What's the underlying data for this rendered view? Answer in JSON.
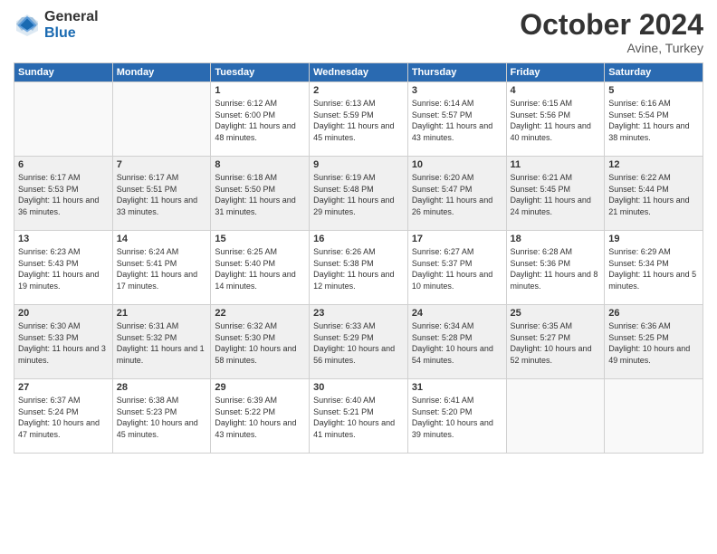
{
  "logo": {
    "general": "General",
    "blue": "Blue"
  },
  "title": "October 2024",
  "location": "Avine, Turkey",
  "days_of_week": [
    "Sunday",
    "Monday",
    "Tuesday",
    "Wednesday",
    "Thursday",
    "Friday",
    "Saturday"
  ],
  "weeks": [
    [
      {
        "day": "",
        "content": ""
      },
      {
        "day": "",
        "content": ""
      },
      {
        "day": "1",
        "content": "Sunrise: 6:12 AM\nSunset: 6:00 PM\nDaylight: 11 hours and 48 minutes."
      },
      {
        "day": "2",
        "content": "Sunrise: 6:13 AM\nSunset: 5:59 PM\nDaylight: 11 hours and 45 minutes."
      },
      {
        "day": "3",
        "content": "Sunrise: 6:14 AM\nSunset: 5:57 PM\nDaylight: 11 hours and 43 minutes."
      },
      {
        "day": "4",
        "content": "Sunrise: 6:15 AM\nSunset: 5:56 PM\nDaylight: 11 hours and 40 minutes."
      },
      {
        "day": "5",
        "content": "Sunrise: 6:16 AM\nSunset: 5:54 PM\nDaylight: 11 hours and 38 minutes."
      }
    ],
    [
      {
        "day": "6",
        "content": "Sunrise: 6:17 AM\nSunset: 5:53 PM\nDaylight: 11 hours and 36 minutes."
      },
      {
        "day": "7",
        "content": "Sunrise: 6:17 AM\nSunset: 5:51 PM\nDaylight: 11 hours and 33 minutes."
      },
      {
        "day": "8",
        "content": "Sunrise: 6:18 AM\nSunset: 5:50 PM\nDaylight: 11 hours and 31 minutes."
      },
      {
        "day": "9",
        "content": "Sunrise: 6:19 AM\nSunset: 5:48 PM\nDaylight: 11 hours and 29 minutes."
      },
      {
        "day": "10",
        "content": "Sunrise: 6:20 AM\nSunset: 5:47 PM\nDaylight: 11 hours and 26 minutes."
      },
      {
        "day": "11",
        "content": "Sunrise: 6:21 AM\nSunset: 5:45 PM\nDaylight: 11 hours and 24 minutes."
      },
      {
        "day": "12",
        "content": "Sunrise: 6:22 AM\nSunset: 5:44 PM\nDaylight: 11 hours and 21 minutes."
      }
    ],
    [
      {
        "day": "13",
        "content": "Sunrise: 6:23 AM\nSunset: 5:43 PM\nDaylight: 11 hours and 19 minutes."
      },
      {
        "day": "14",
        "content": "Sunrise: 6:24 AM\nSunset: 5:41 PM\nDaylight: 11 hours and 17 minutes."
      },
      {
        "day": "15",
        "content": "Sunrise: 6:25 AM\nSunset: 5:40 PM\nDaylight: 11 hours and 14 minutes."
      },
      {
        "day": "16",
        "content": "Sunrise: 6:26 AM\nSunset: 5:38 PM\nDaylight: 11 hours and 12 minutes."
      },
      {
        "day": "17",
        "content": "Sunrise: 6:27 AM\nSunset: 5:37 PM\nDaylight: 11 hours and 10 minutes."
      },
      {
        "day": "18",
        "content": "Sunrise: 6:28 AM\nSunset: 5:36 PM\nDaylight: 11 hours and 8 minutes."
      },
      {
        "day": "19",
        "content": "Sunrise: 6:29 AM\nSunset: 5:34 PM\nDaylight: 11 hours and 5 minutes."
      }
    ],
    [
      {
        "day": "20",
        "content": "Sunrise: 6:30 AM\nSunset: 5:33 PM\nDaylight: 11 hours and 3 minutes."
      },
      {
        "day": "21",
        "content": "Sunrise: 6:31 AM\nSunset: 5:32 PM\nDaylight: 11 hours and 1 minute."
      },
      {
        "day": "22",
        "content": "Sunrise: 6:32 AM\nSunset: 5:30 PM\nDaylight: 10 hours and 58 minutes."
      },
      {
        "day": "23",
        "content": "Sunrise: 6:33 AM\nSunset: 5:29 PM\nDaylight: 10 hours and 56 minutes."
      },
      {
        "day": "24",
        "content": "Sunrise: 6:34 AM\nSunset: 5:28 PM\nDaylight: 10 hours and 54 minutes."
      },
      {
        "day": "25",
        "content": "Sunrise: 6:35 AM\nSunset: 5:27 PM\nDaylight: 10 hours and 52 minutes."
      },
      {
        "day": "26",
        "content": "Sunrise: 6:36 AM\nSunset: 5:25 PM\nDaylight: 10 hours and 49 minutes."
      }
    ],
    [
      {
        "day": "27",
        "content": "Sunrise: 6:37 AM\nSunset: 5:24 PM\nDaylight: 10 hours and 47 minutes."
      },
      {
        "day": "28",
        "content": "Sunrise: 6:38 AM\nSunset: 5:23 PM\nDaylight: 10 hours and 45 minutes."
      },
      {
        "day": "29",
        "content": "Sunrise: 6:39 AM\nSunset: 5:22 PM\nDaylight: 10 hours and 43 minutes."
      },
      {
        "day": "30",
        "content": "Sunrise: 6:40 AM\nSunset: 5:21 PM\nDaylight: 10 hours and 41 minutes."
      },
      {
        "day": "31",
        "content": "Sunrise: 6:41 AM\nSunset: 5:20 PM\nDaylight: 10 hours and 39 minutes."
      },
      {
        "day": "",
        "content": ""
      },
      {
        "day": "",
        "content": ""
      }
    ]
  ]
}
